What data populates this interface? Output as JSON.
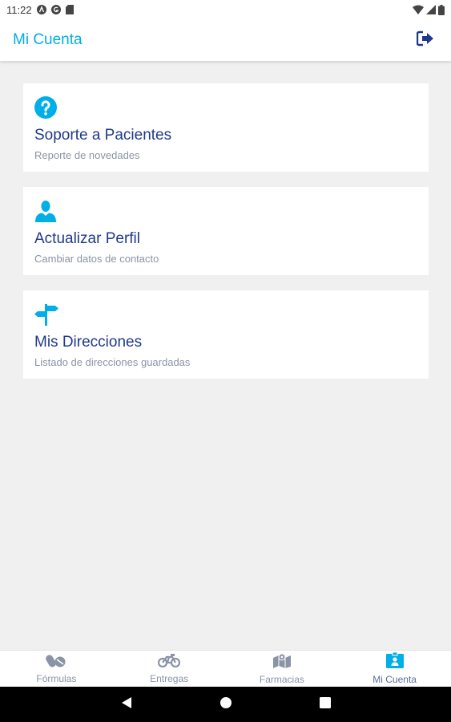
{
  "status_bar": {
    "time": "11:22"
  },
  "app_bar": {
    "title": "Mi Cuenta",
    "action_icon": "logout-icon"
  },
  "cards": [
    {
      "title": "Soporte a Pacientes",
      "subtitle": "Reporte de novedades",
      "icon": "help-icon"
    },
    {
      "title": "Actualizar Perfil",
      "subtitle": "Cambiar datos de contacto",
      "icon": "user-icon"
    },
    {
      "title": "Mis Direcciones",
      "subtitle": "Listado de direcciones guardadas",
      "icon": "signpost-icon"
    }
  ],
  "bottom_nav": {
    "items": [
      {
        "label": "Fórmulas",
        "icon": "pills-icon",
        "active": false
      },
      {
        "label": "Entregas",
        "icon": "motorcycle-icon",
        "active": false
      },
      {
        "label": "Farmacias",
        "icon": "map-icon",
        "active": false
      },
      {
        "label": "Mi Cuenta",
        "icon": "id-badge-icon",
        "active": true
      }
    ]
  },
  "colors": {
    "accent": "#00aee8",
    "title": "#1f3a8a",
    "subtitle": "#8a94a6",
    "background": "#f0f0f0"
  }
}
